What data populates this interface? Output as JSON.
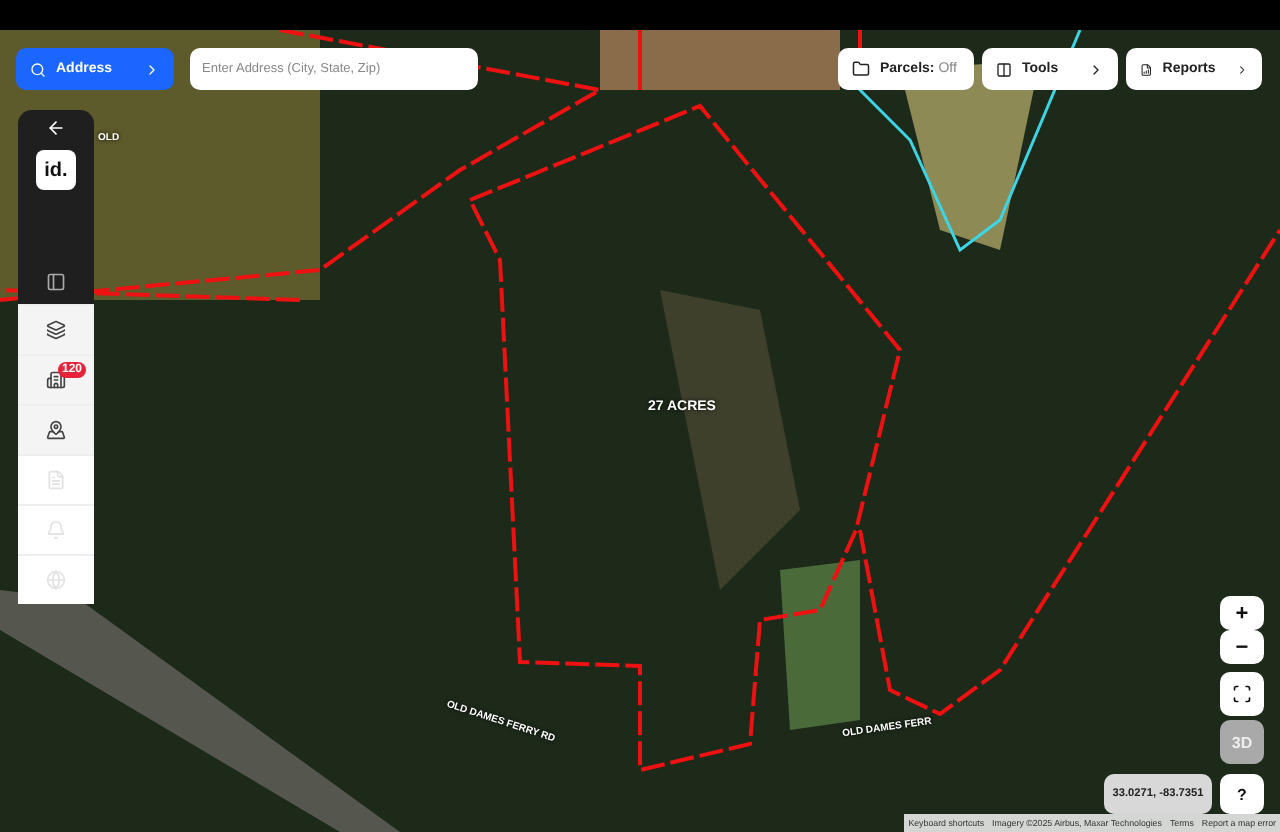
{
  "search": {
    "mode_button": "Address",
    "placeholder": "Enter Address (City, State, Zip)"
  },
  "toolbar": [
    {
      "kind": "parcels",
      "label": "Parcels:",
      "value": "Off"
    },
    {
      "kind": "menu",
      "label": "Tools"
    },
    {
      "kind": "menu",
      "label": "Reports"
    }
  ],
  "sidebar": {
    "logo": "id.",
    "items": [
      {
        "kind": "layers",
        "disabled": false
      },
      {
        "kind": "buildings",
        "disabled": false,
        "badge": "120"
      },
      {
        "kind": "location",
        "disabled": false
      },
      {
        "kind": "document",
        "disabled": true
      },
      {
        "kind": "bell",
        "disabled": true
      },
      {
        "kind": "globe",
        "disabled": true
      }
    ]
  },
  "map": {
    "labels": [
      {
        "kind": "parcel",
        "text": "27 ACRES"
      },
      {
        "kind": "road",
        "text": "OLD"
      },
      {
        "kind": "road",
        "text": "OLD DAMES FERRY RD"
      },
      {
        "kind": "road",
        "text": "OLD DAMES FERR"
      }
    ]
  },
  "controls": {
    "zoom_in": "+",
    "zoom_out": "−",
    "three_d": "3D",
    "help": "?",
    "coordinates": "33.0271, -83.7351"
  },
  "attribution": [
    "Keyboard shortcuts",
    "Imagery ©2025 Airbus, Maxar Technologies",
    "Terms",
    "Report a map error"
  ]
}
